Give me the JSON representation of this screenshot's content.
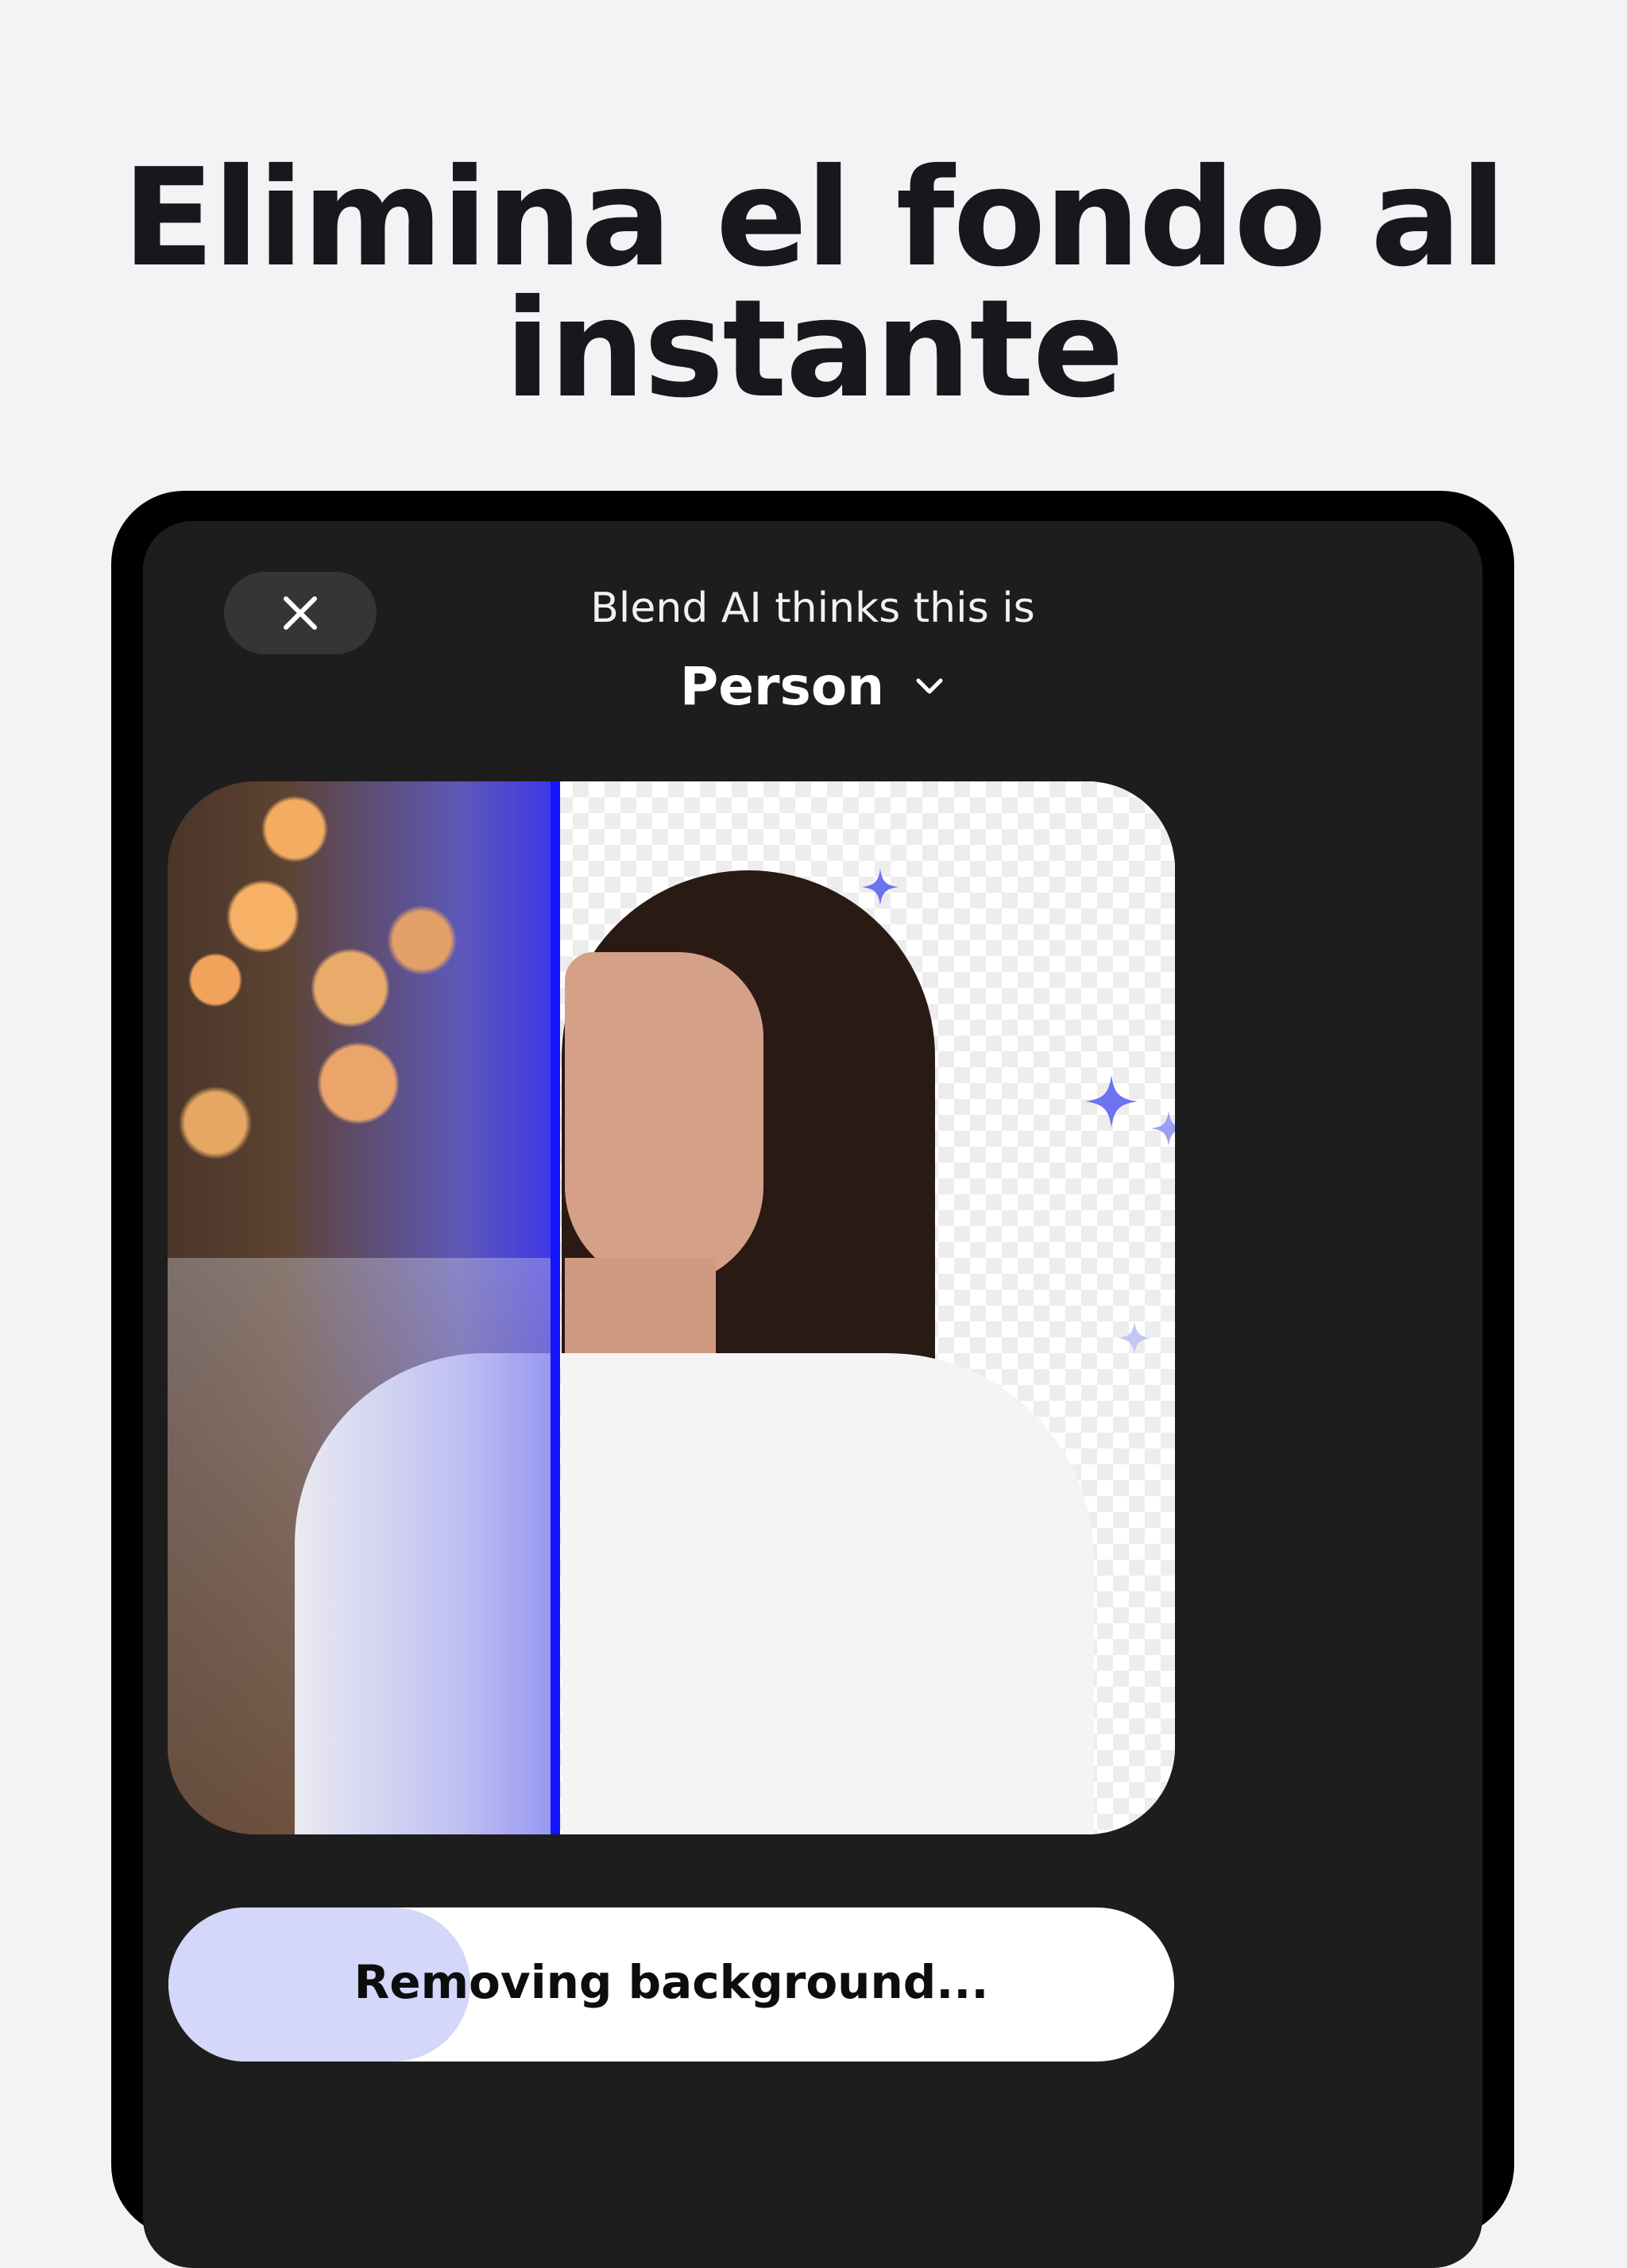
{
  "headline": {
    "line1": "Elimina el fondo al",
    "line2": "instante"
  },
  "modal": {
    "close_icon": "close-icon",
    "subtitle": "Blend AI thinks this is",
    "category": "Person",
    "category_icon": "chevron-down-icon"
  },
  "preview": {
    "divider_color": "#1414ff",
    "sparkle_color": "#6b73f0"
  },
  "progress": {
    "label": "Removing background...",
    "fraction": 0.3,
    "fill_color": "#d4d6fa"
  }
}
